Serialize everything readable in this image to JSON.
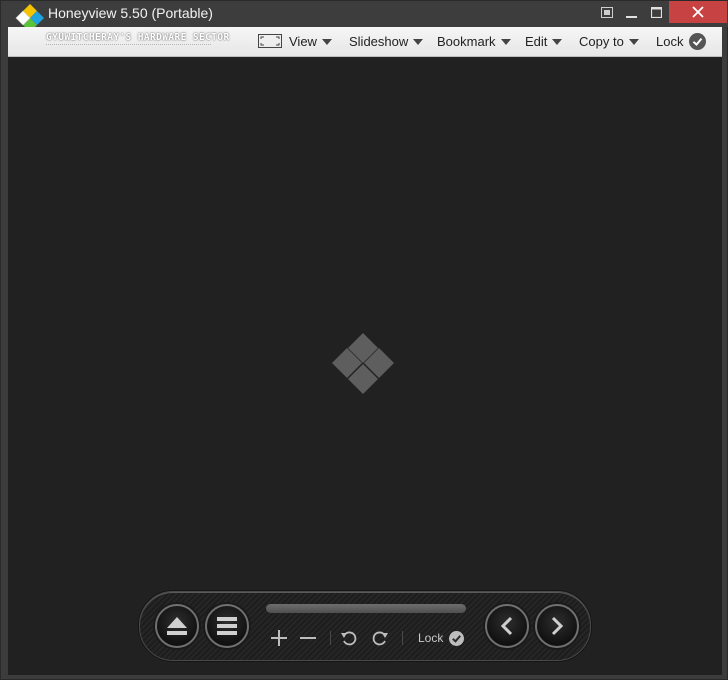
{
  "window": {
    "title": "Honeyview 5.50 (Portable)"
  },
  "toolbar": {
    "watermark": "GYUWITCHERAY'S HARDWARE SECTOR",
    "view_label": "View",
    "slideshow_label": "Slideshow",
    "bookmark_label": "Bookmark",
    "edit_label": "Edit",
    "copy_to_label": "Copy to",
    "lock_label": "Lock"
  },
  "dock": {
    "lock_label": "Lock"
  },
  "colors": {
    "viewer_bg": "#212121",
    "close_button": "#c74343",
    "toolbar_bg": "#efefef"
  }
}
